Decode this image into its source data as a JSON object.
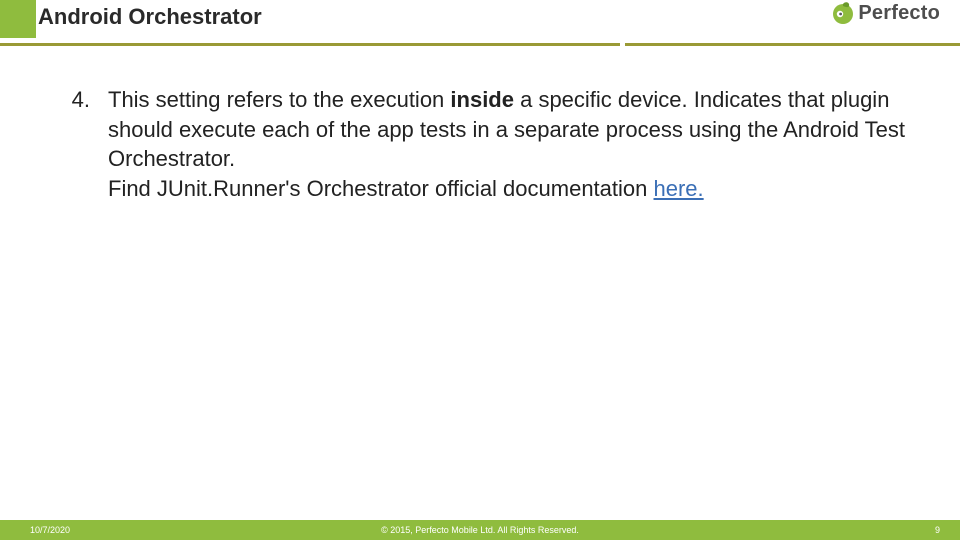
{
  "header": {
    "title": "Android Orchestrator",
    "brand": "Perfecto"
  },
  "content": {
    "item_number": "4.",
    "text_part1": "This setting refers to the execution ",
    "text_bold": "inside",
    "text_part2": " a specific device. Indicates that plugin should execute each of the app tests in a separate process using the Android Test Orchestrator.",
    "text_part3": " Find JUnit.Runner's Orchestrator official documentation ",
    "link_text": "here."
  },
  "footer": {
    "date": "10/7/2020",
    "copyright": "© 2015, Perfecto Mobile Ltd. All Rights Reserved.",
    "page": "9"
  }
}
